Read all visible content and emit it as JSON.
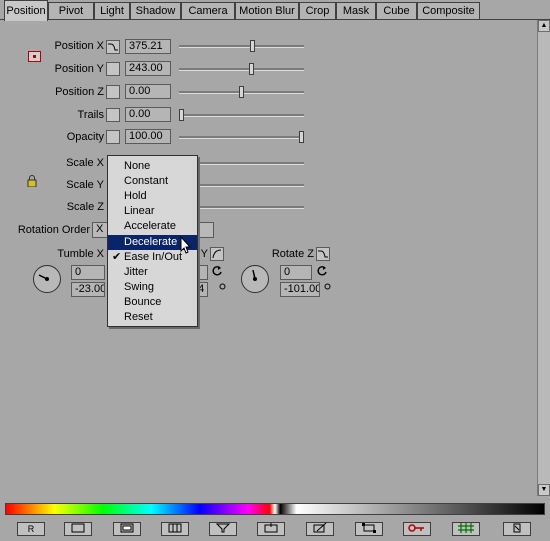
{
  "tabs": [
    "Position",
    "Pivot",
    "Light",
    "Shadow",
    "Camera",
    "Motion Blur",
    "Crop",
    "Mask",
    "Cube",
    "Composite"
  ],
  "active_tab": "Position",
  "rows": [
    {
      "label": "Position X",
      "value": "375.21",
      "slider_pct": 0.59
    },
    {
      "label": "Position Y",
      "value": "243.00",
      "slider_pct": 0.58
    },
    {
      "label": "Position Z",
      "value": "0.00",
      "slider_pct": 0.5
    },
    {
      "label": "Trails",
      "value": "0.00",
      "slider_pct": 0.0
    },
    {
      "label": "Opacity",
      "value": "100.00",
      "slider_pct": 1.0
    }
  ],
  "scale_labels": [
    "Scale X",
    "Scale Y",
    "Scale Z"
  ],
  "rotation_order_label": "Rotation Order",
  "rotation_order_value": "X",
  "rotations": [
    {
      "label": "Tumble X",
      "turns": "0",
      "degrees": "-23.00"
    },
    {
      "label": "Y",
      "turns": "",
      "degrees": "64"
    },
    {
      "label": "Rotate Z",
      "turns": "0",
      "degrees": "-101.00"
    }
  ],
  "menu": {
    "items": [
      "None",
      "Constant",
      "Hold",
      "Linear",
      "Accelerate",
      "Decelerate",
      "Ease In/Out",
      "Jitter",
      "Swing",
      "Bounce",
      "Reset"
    ],
    "highlighted": "Decelerate",
    "checked": "Ease In/Out"
  },
  "toolbar_icons": [
    "render-icon",
    "frame-icon",
    "frame-filled-icon",
    "film-icon",
    "filter-icon",
    "fit-icon",
    "pen-icon",
    "crop-icon",
    "key-icon",
    "grid-icon",
    "delete-icon"
  ],
  "colors": {
    "highlight": "#0a246a",
    "panel": "#a7a7a7",
    "key": "#b00000",
    "grid": "#007000"
  }
}
